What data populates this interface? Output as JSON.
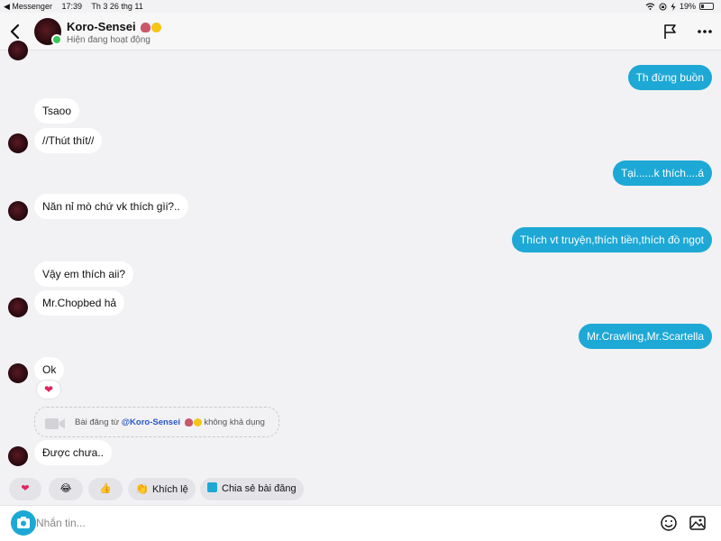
{
  "status_bar": {
    "back_app": "◀ Messenger",
    "time": "17:39",
    "date": "Th 3 26 thg 11",
    "battery": "19%"
  },
  "header": {
    "contact_name": "Koro-Sensei",
    "status": "Hiện đang hoạt động"
  },
  "messages": [
    {
      "side": "out",
      "text": "Th đừng buồn"
    },
    {
      "side": "in",
      "text": "Tsaoo"
    },
    {
      "side": "in",
      "text": "//Thút thít//"
    },
    {
      "side": "out",
      "text": "Tại......k thích....á"
    },
    {
      "side": "in",
      "text": "Năn nỉ mò chứ vk thích gìi?.."
    },
    {
      "side": "out",
      "text": "Thích vt truyện,thích tiền,thích đồ ngọt"
    },
    {
      "side": "in",
      "text": "Vậy em thích aii?"
    },
    {
      "side": "in",
      "text": "Mr.Chopbed hả"
    },
    {
      "side": "out",
      "text": "Mr.Crawling,Mr.Scartella"
    },
    {
      "side": "in",
      "text": "Ok"
    },
    {
      "side": "in",
      "text": "Được chưa.."
    }
  ],
  "reaction": "❤",
  "unavailable_post": {
    "prefix": "Bài đăng từ",
    "handle": "@Koro-Sensei",
    "suffix": "không khả dụng"
  },
  "quick_replies": [
    {
      "icon": "❤"
    },
    {
      "icon": "😂"
    },
    {
      "icon": "👍"
    },
    {
      "icon": "👏",
      "label": "Khích lệ"
    },
    {
      "label": "Chia sẻ bài đăng"
    }
  ],
  "composer": {
    "placeholder": "Nhắn tin..."
  },
  "colors": {
    "outgoing_bubble": "#1ea8d6",
    "incoming_bubble": "#ffffff",
    "online": "#35c759"
  }
}
